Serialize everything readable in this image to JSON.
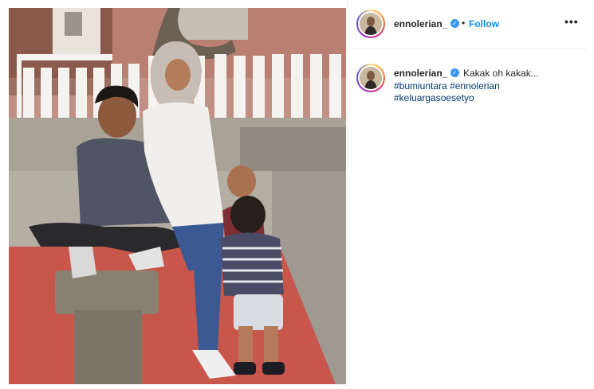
{
  "header": {
    "username": "ennolerian_",
    "verified_mark": "✓",
    "separator": "•",
    "follow_label": "Follow",
    "more_label": "•••"
  },
  "caption": {
    "username": "ennolerian_",
    "verified_mark": "✓",
    "text": "Kakak oh kakak...",
    "hashtags": [
      "#bumiuntara",
      "#ennolerian",
      "#keluargasoesetyo"
    ]
  },
  "icons": {
    "verified": "verified-badge-icon",
    "more": "more-options-icon"
  },
  "colors": {
    "follow": "#0095f6",
    "hashtag": "#00376b",
    "verified": "#3897f0",
    "text": "#262626"
  }
}
